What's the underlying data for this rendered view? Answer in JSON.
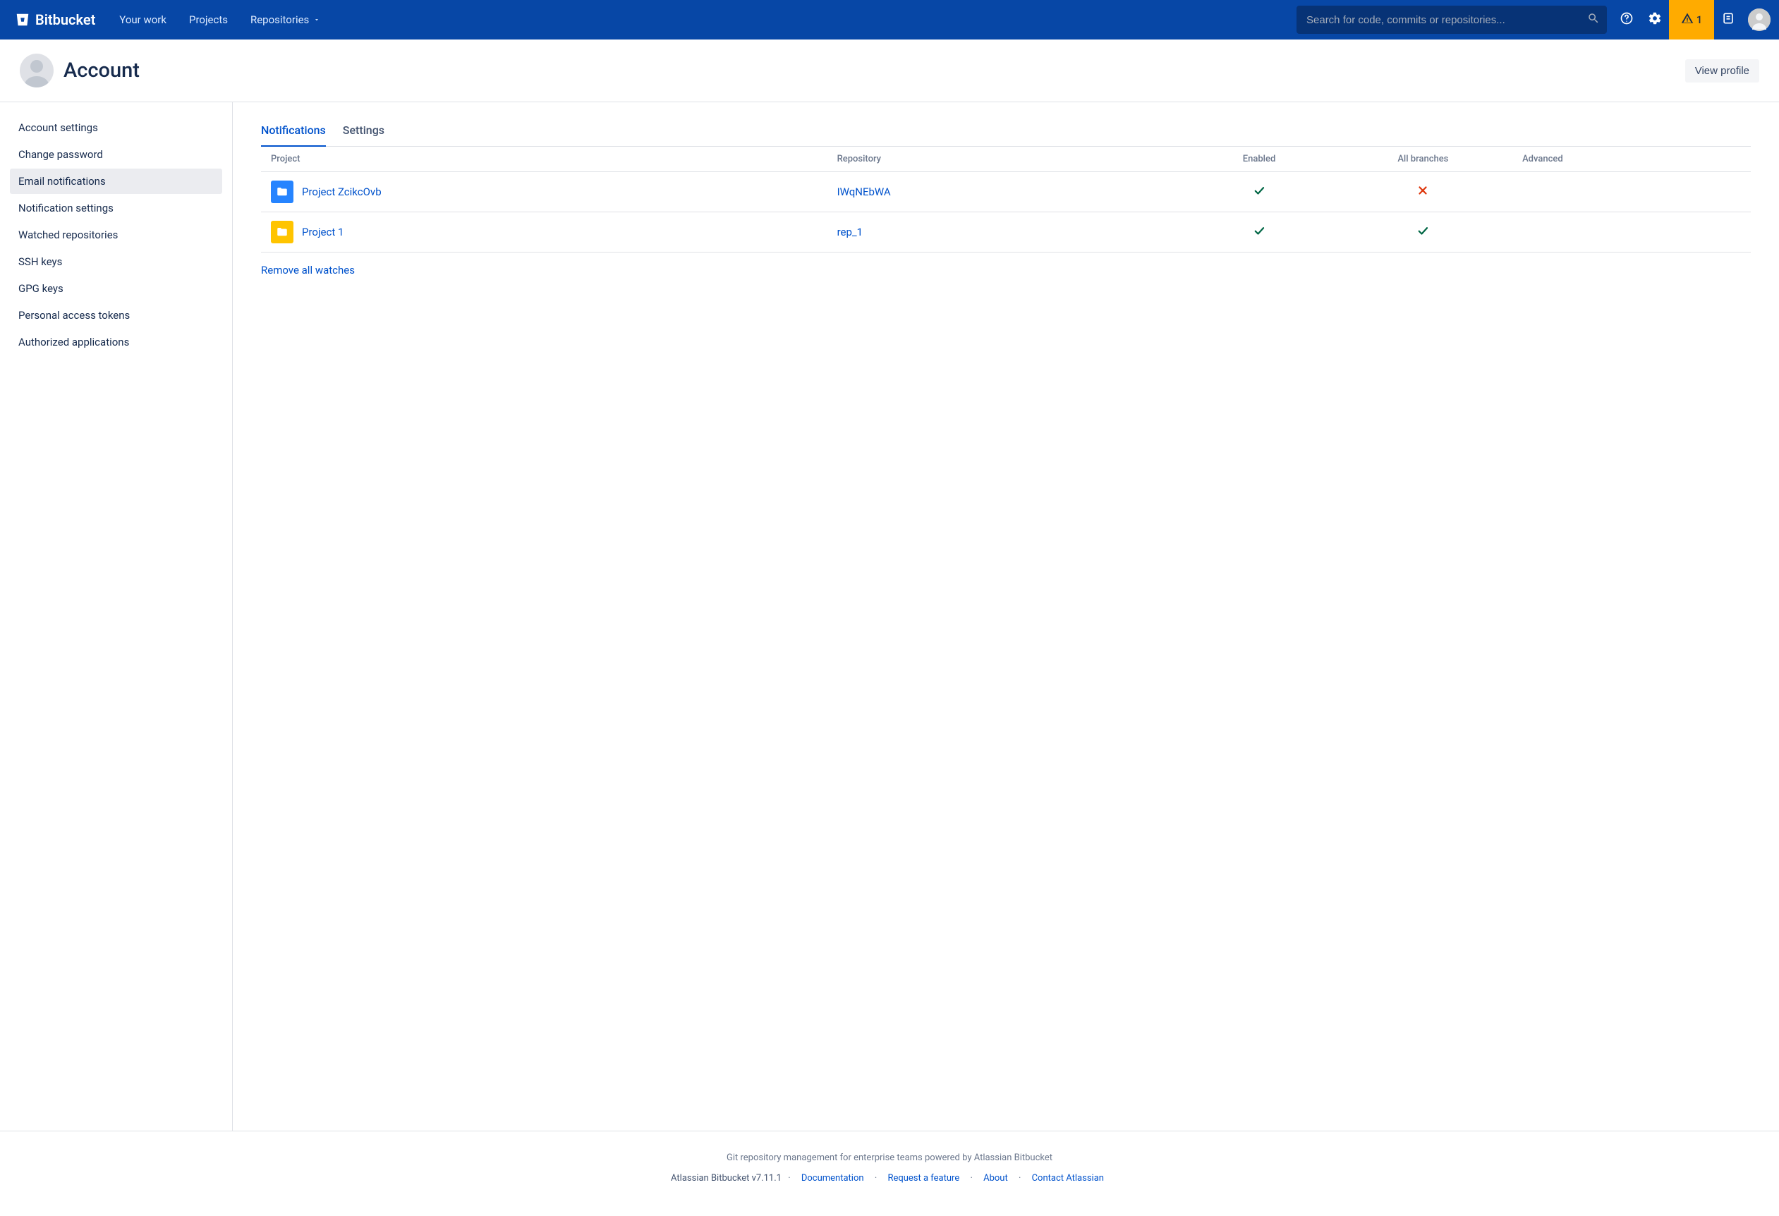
{
  "nav": {
    "brand": "Bitbucket",
    "links": {
      "your_work": "Your work",
      "projects": "Projects",
      "repositories": "Repositories"
    },
    "search_placeholder": "Search for code, commits or repositories...",
    "alert_count": "1"
  },
  "header": {
    "title": "Account",
    "view_profile": "View profile"
  },
  "sidebar": {
    "items": [
      "Account settings",
      "Change password",
      "Email notifications",
      "Notification settings",
      "Watched repositories",
      "SSH keys",
      "GPG keys",
      "Personal access tokens",
      "Authorized applications"
    ],
    "active_index": 2
  },
  "tabs": {
    "notifications": "Notifications",
    "settings": "Settings",
    "active": "notifications"
  },
  "table": {
    "headers": {
      "project": "Project",
      "repository": "Repository",
      "enabled": "Enabled",
      "all_branches": "All branches",
      "advanced": "Advanced"
    },
    "rows": [
      {
        "project": "Project ZcikcOvb",
        "repo": "IWqNEbWA",
        "icon_color": "blue",
        "enabled": true,
        "all_branches": false,
        "advanced": ""
      },
      {
        "project": "Project 1",
        "repo": "rep_1",
        "icon_color": "yellow",
        "enabled": true,
        "all_branches": true,
        "advanced": ""
      }
    ],
    "remove_all": "Remove all watches"
  },
  "footer": {
    "tagline": "Git repository management for enterprise teams powered by Atlassian Bitbucket",
    "version": "Atlassian Bitbucket v7.11.1",
    "links": {
      "documentation": "Documentation",
      "request_feature": "Request a feature",
      "about": "About",
      "contact": "Contact Atlassian"
    }
  }
}
